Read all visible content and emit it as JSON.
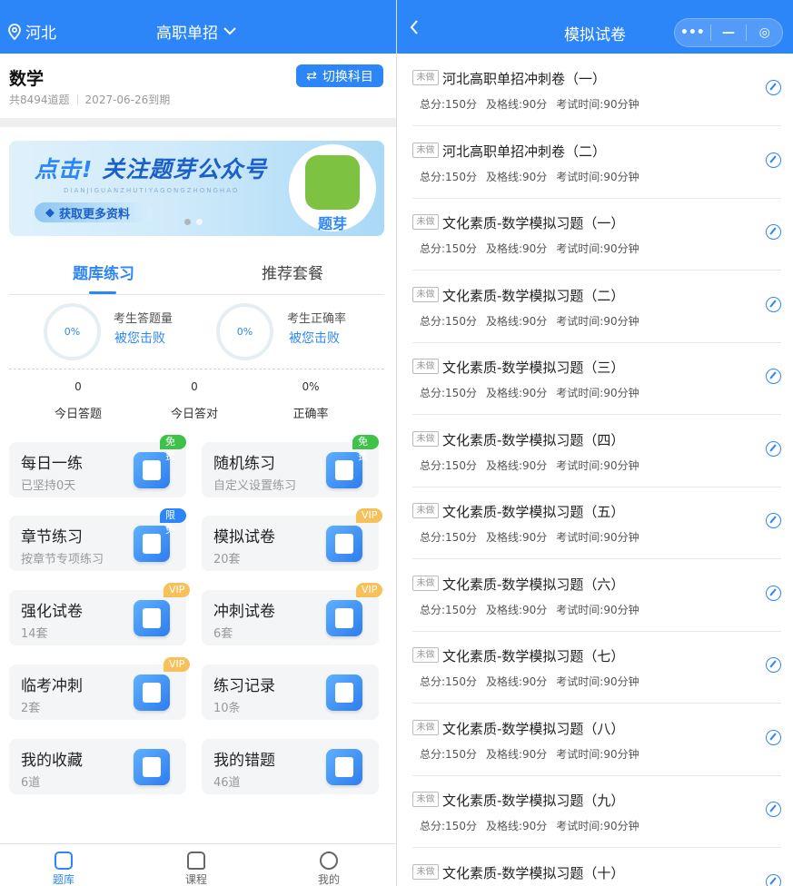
{
  "left": {
    "header": {
      "location": "河北",
      "level": "高职单招"
    },
    "subject": {
      "title": "数学",
      "count": "共8494道题",
      "expire": "2027-06-26到期",
      "switch_label": "切换科目"
    },
    "banner": {
      "title_highlight": "点击!",
      "title_rest": "关注题芽公众号",
      "subtitle": "DIANJIGUANZHUTIYAGONGZHONGHAO",
      "pill": "获取更多资料",
      "logo_text": "题芽"
    },
    "tabs": [
      "题库练习",
      "推荐套餐"
    ],
    "rings": [
      {
        "value": "0%",
        "label": "考生答题量",
        "link": "被您击败"
      },
      {
        "value": "0%",
        "label": "考生正确率",
        "link": "被您击败"
      }
    ],
    "stats": [
      {
        "value": "0",
        "label": "今日答题"
      },
      {
        "value": "0",
        "label": "今日答对"
      },
      {
        "value": "0%",
        "label": "正确率"
      }
    ],
    "cards": [
      {
        "title": "每日一练",
        "sub": "已坚持0天",
        "badge": "免费",
        "badge_type": "free",
        "icon": "calendar-icon"
      },
      {
        "title": "随机练习",
        "sub": "自定义设置练习",
        "badge": "免费",
        "badge_type": "free",
        "icon": "shuffle-icon"
      },
      {
        "title": "章节练习",
        "sub": "按章节专项练习",
        "badge": "限免",
        "badge_type": "limit",
        "icon": "folder-icon"
      },
      {
        "title": "模拟试卷",
        "sub": "20套",
        "badge": "VIP",
        "badge_type": "vip",
        "icon": "pencil-icon"
      },
      {
        "title": "强化试卷",
        "sub": "14套",
        "badge": "VIP",
        "badge_type": "vip",
        "icon": "pencil-icon"
      },
      {
        "title": "冲刺试卷",
        "sub": "6套",
        "badge": "VIP",
        "badge_type": "vip",
        "icon": "pencil-icon"
      },
      {
        "title": "临考冲刺",
        "sub": "2套",
        "badge": "VIP",
        "badge_type": "vip",
        "icon": "pencil-icon"
      },
      {
        "title": "练习记录",
        "sub": "10条",
        "badge": "",
        "badge_type": "",
        "icon": "record-icon"
      },
      {
        "title": "我的收藏",
        "sub": "6道",
        "badge": "",
        "badge_type": "",
        "icon": "star-icon"
      },
      {
        "title": "我的错题",
        "sub": "46道",
        "badge": "",
        "badge_type": "",
        "icon": "wrong-icon"
      }
    ],
    "nav": [
      "题库",
      "课程",
      "我的"
    ],
    "colors": {
      "primary": "#2d86f7",
      "free": "#3fc24a",
      "vip": "#f6c05a"
    }
  },
  "right": {
    "header": {
      "title": "模拟试卷"
    },
    "exams": [
      {
        "tag": "未做",
        "name": "河北高职单招冲刺卷（一）",
        "total": "总分:150分",
        "pass": "及格线:90分",
        "time": "考试时间:90分钟"
      },
      {
        "tag": "未做",
        "name": "河北高职单招冲刺卷（二）",
        "total": "总分:150分",
        "pass": "及格线:90分",
        "time": "考试时间:90分钟"
      },
      {
        "tag": "未做",
        "name": "文化素质-数学模拟习题（一）",
        "total": "总分:150分",
        "pass": "及格线:90分",
        "time": "考试时间:90分钟"
      },
      {
        "tag": "未做",
        "name": "文化素质-数学模拟习题（二）",
        "total": "总分:150分",
        "pass": "及格线:90分",
        "time": "考试时间:90分钟"
      },
      {
        "tag": "未做",
        "name": "文化素质-数学模拟习题（三）",
        "total": "总分:150分",
        "pass": "及格线:90分",
        "time": "考试时间:90分钟"
      },
      {
        "tag": "未做",
        "name": "文化素质-数学模拟习题（四）",
        "total": "总分:150分",
        "pass": "及格线:90分",
        "time": "考试时间:90分钟"
      },
      {
        "tag": "未做",
        "name": "文化素质-数学模拟习题（五）",
        "total": "总分:150分",
        "pass": "及格线:90分",
        "time": "考试时间:90分钟"
      },
      {
        "tag": "未做",
        "name": "文化素质-数学模拟习题（六）",
        "total": "总分:150分",
        "pass": "及格线:90分",
        "time": "考试时间:90分钟"
      },
      {
        "tag": "未做",
        "name": "文化素质-数学模拟习题（七）",
        "total": "总分:150分",
        "pass": "及格线:90分",
        "time": "考试时间:90分钟"
      },
      {
        "tag": "未做",
        "name": "文化素质-数学模拟习题（八）",
        "total": "总分:150分",
        "pass": "及格线:90分",
        "time": "考试时间:90分钟"
      },
      {
        "tag": "未做",
        "name": "文化素质-数学模拟习题（九）",
        "total": "总分:150分",
        "pass": "及格线:90分",
        "time": "考试时间:90分钟"
      },
      {
        "tag": "未做",
        "name": "文化素质-数学模拟习题（十）",
        "total": "",
        "pass": "",
        "time": ""
      }
    ]
  }
}
